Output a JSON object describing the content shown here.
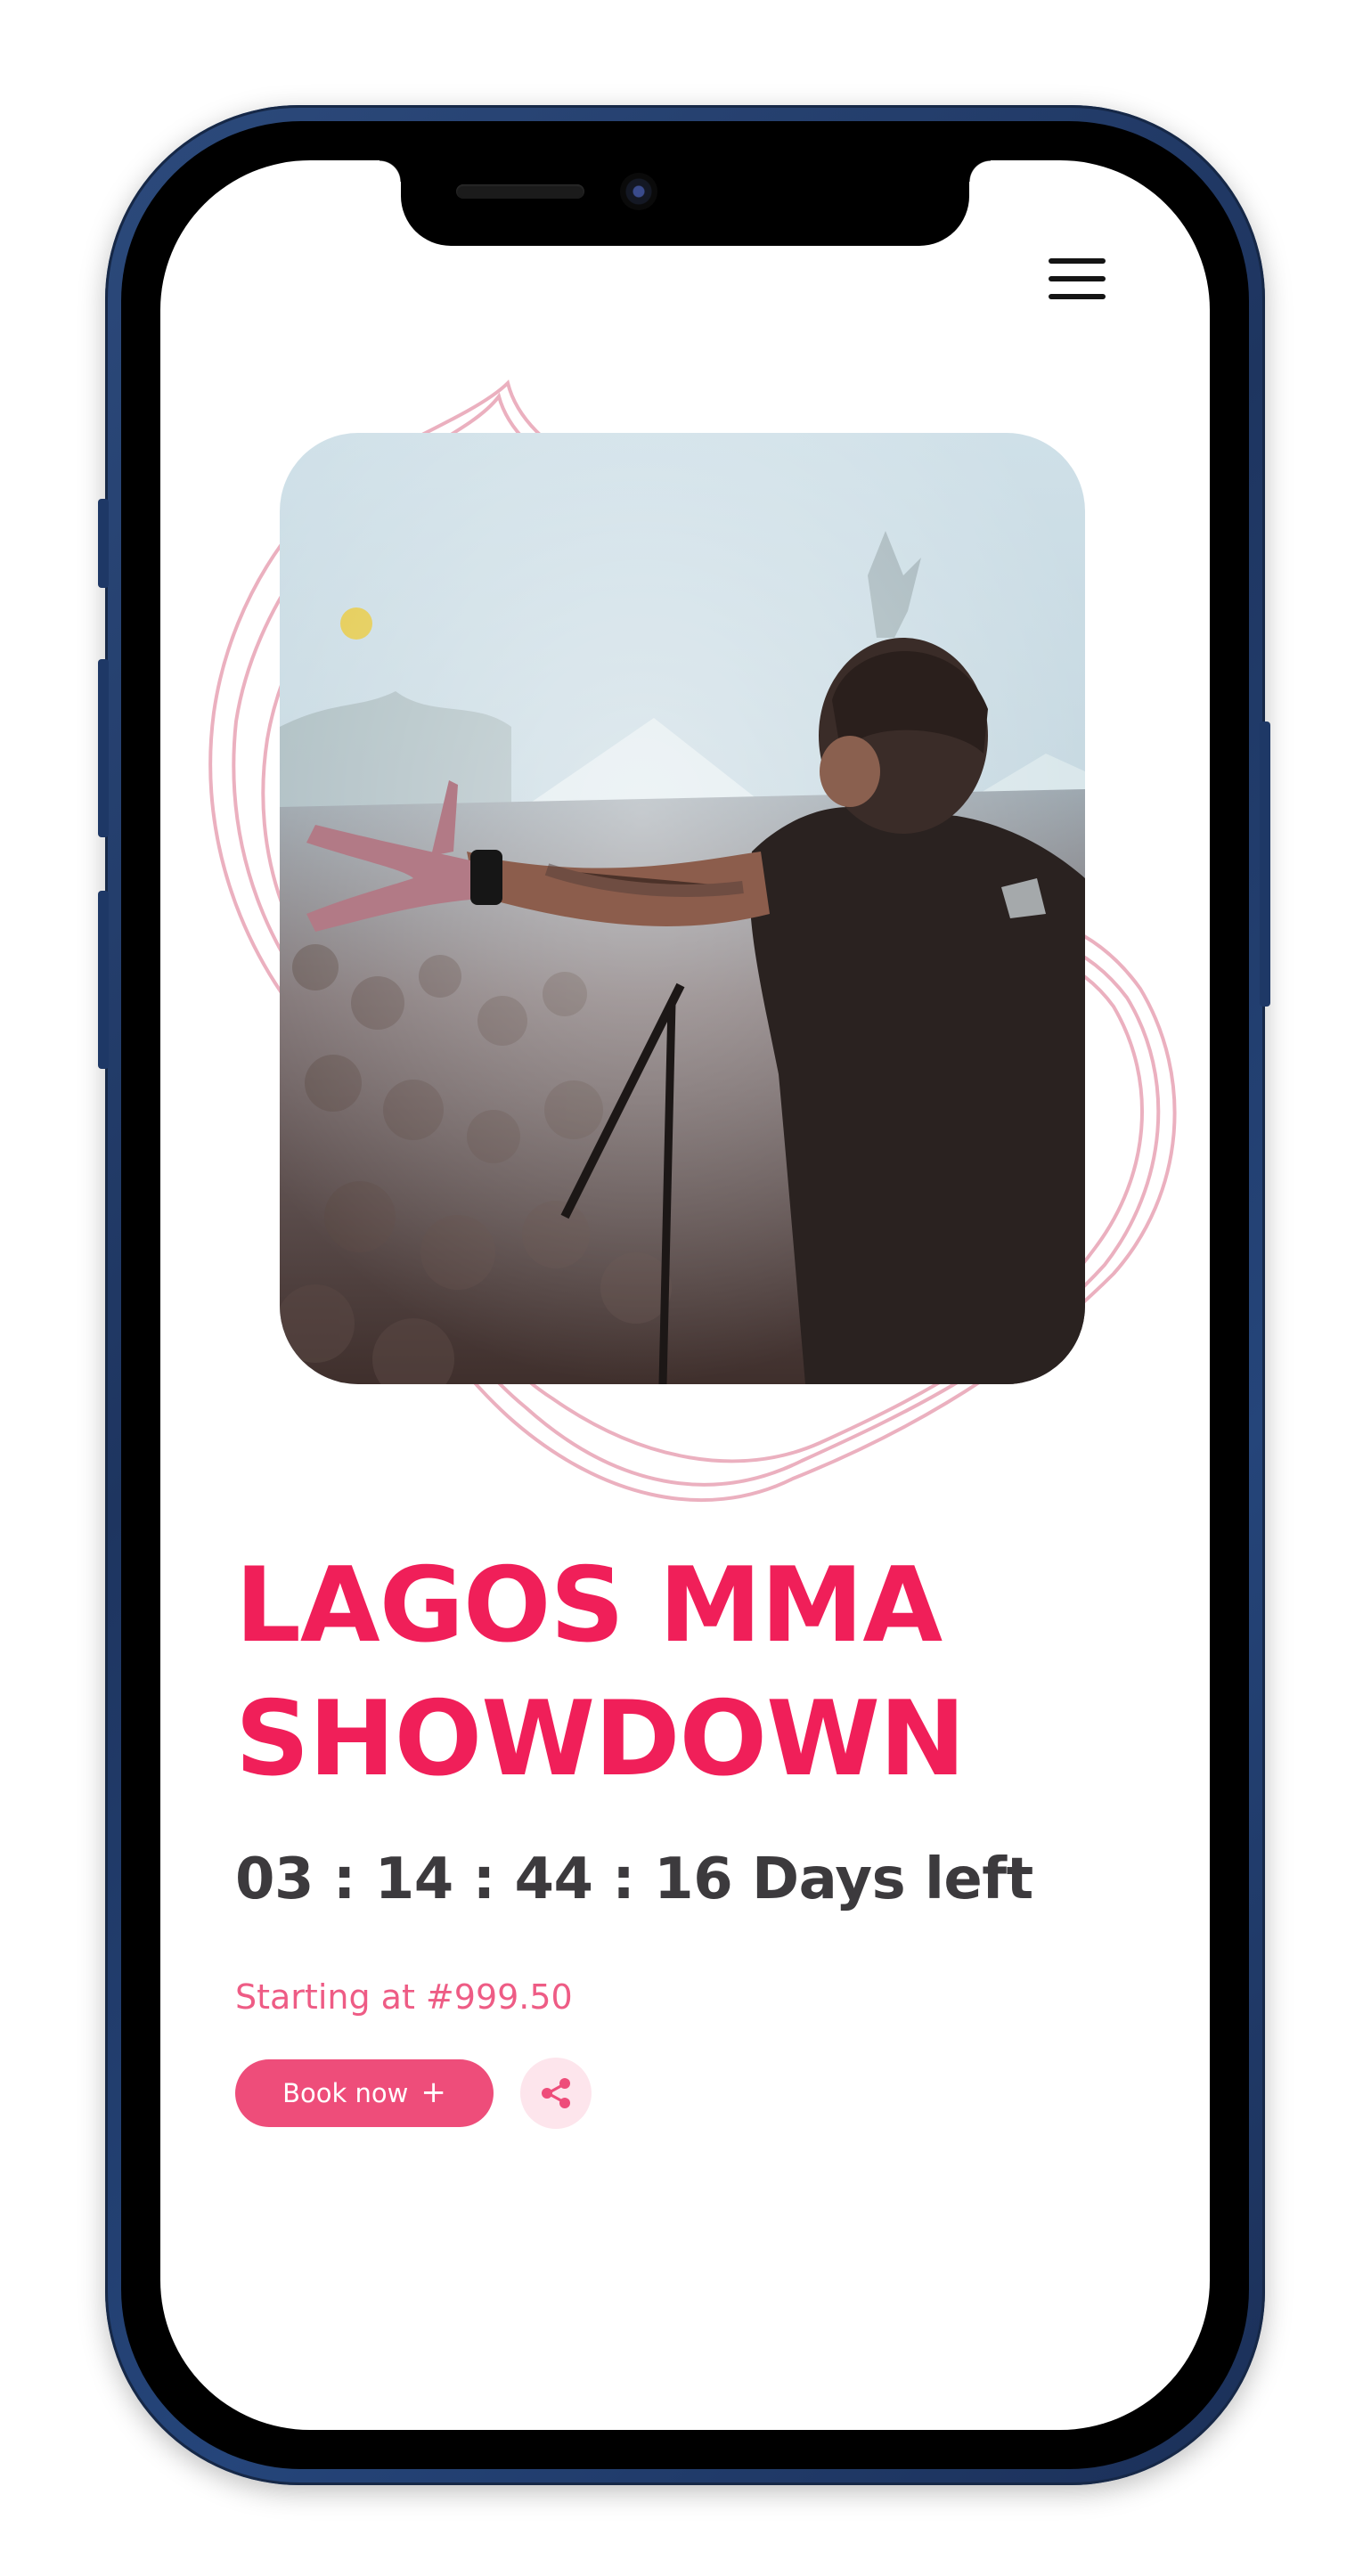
{
  "device": {
    "model": "smartphone",
    "frame_color": "#1e3560"
  },
  "header": {
    "menu_icon": "hamburger-menu-icon"
  },
  "hero": {
    "image_alt": "Performer on stage reaching toward a festival crowd",
    "zoom_icon": "zoom-in-icon"
  },
  "event": {
    "title": "LAGOS MMA SHOWDOWN",
    "countdown": "03 : 14 : 44 : 16 Days left",
    "price_text": "Starting at #999.50"
  },
  "actions": {
    "book_label": "Book now",
    "book_icon": "plus-icon",
    "share_icon": "share-icon"
  },
  "colors": {
    "accent": "#f01f59",
    "button": "#ee4d7a",
    "price": "#ee5c85",
    "countdown": "#3c3a3d",
    "scribble": "#e8a3b5",
    "share_bg": "#fde5ec"
  }
}
